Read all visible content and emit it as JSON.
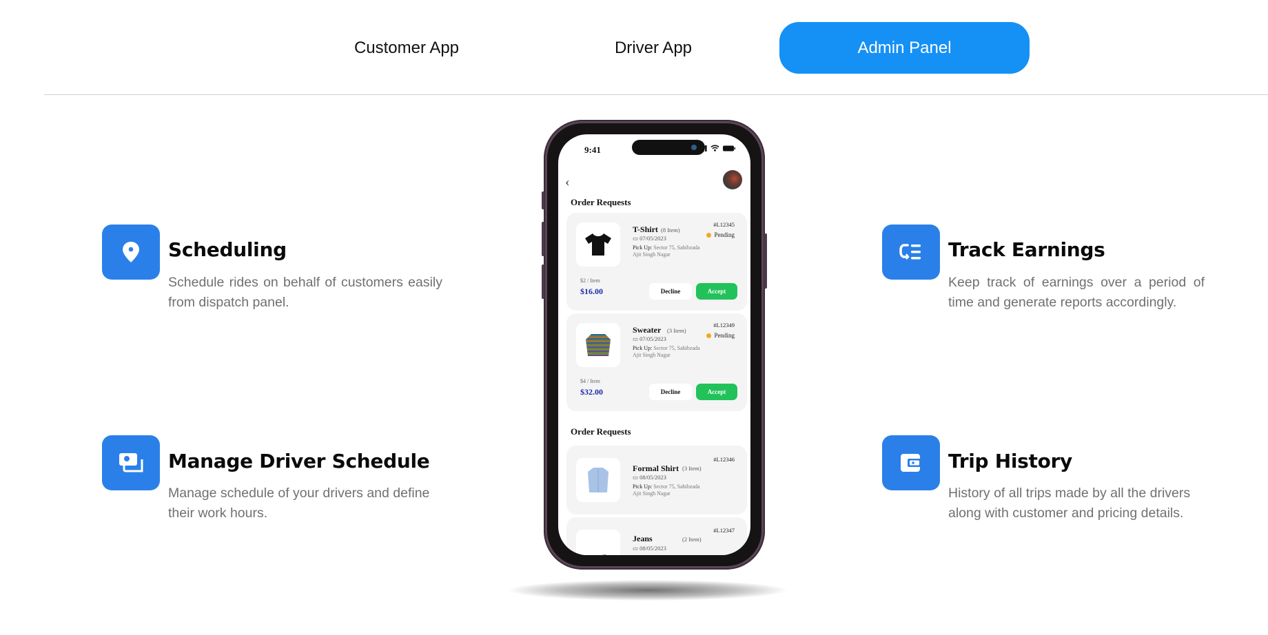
{
  "tabs": [
    {
      "label": "Customer App",
      "active": false
    },
    {
      "label": "Driver App",
      "active": false
    },
    {
      "label": "Admin Panel",
      "active": true
    }
  ],
  "colors": {
    "accent": "#1590f5",
    "icon_bg": "#2a80e8",
    "accept": "#22c25a",
    "pending": "#f3a81e",
    "price": "#1f2aa8"
  },
  "features": [
    {
      "icon": "location-pin-icon",
      "title": "Scheduling",
      "description": "Schedule rides on behalf of customers easily from dispatch panel."
    },
    {
      "icon": "driver-card-icon",
      "title": "Manage Driver Schedule",
      "description": "Manage schedule of your drivers and define their work hours."
    },
    {
      "icon": "earnings-list-icon",
      "title": "Track Earnings",
      "description": "Keep track of earnings over a period of time and generate reports accordingly."
    },
    {
      "icon": "wallet-icon",
      "title": "Trip History",
      "description": "History of all trips made by all the drivers along with customer and pricing details."
    }
  ],
  "phone": {
    "time": "9:41",
    "sections": [
      "Order Requests",
      "Order Requests"
    ],
    "orders": [
      {
        "name": "T-Shirt",
        "count": "(8 Item)",
        "date": "07/05/2023",
        "pickup_label": "Pick Up:",
        "pickup": "Sector 75, Sahibzada Ajit Singh Nagar",
        "id": "#L12345",
        "status": "Pending",
        "unit_price": "$2 / Item",
        "total": "$16.00",
        "decline": "Decline",
        "accept": "Accept"
      },
      {
        "name": "Sweater",
        "count": "(3 Item)",
        "date": "07/05/2023",
        "pickup_label": "Pick Up:",
        "pickup": "Sector 75, Sahibzada Ajit Singh Nagar",
        "id": "#L12349",
        "status": "Pending",
        "unit_price": "$4 / Item",
        "total": "$32.00",
        "decline": "Decline",
        "accept": "Accept"
      },
      {
        "name": "Formal Shirt",
        "count": "(3 Item)",
        "date": "08/05/2023",
        "pickup_label": "Pick Up:",
        "pickup": "Sector 75, Sahibzada Ajit Singh Nagar",
        "id": "#L12346"
      },
      {
        "name": "Jeans",
        "count": "(2 Item)",
        "date": "08/05/2023",
        "id": "#L12347"
      }
    ]
  }
}
